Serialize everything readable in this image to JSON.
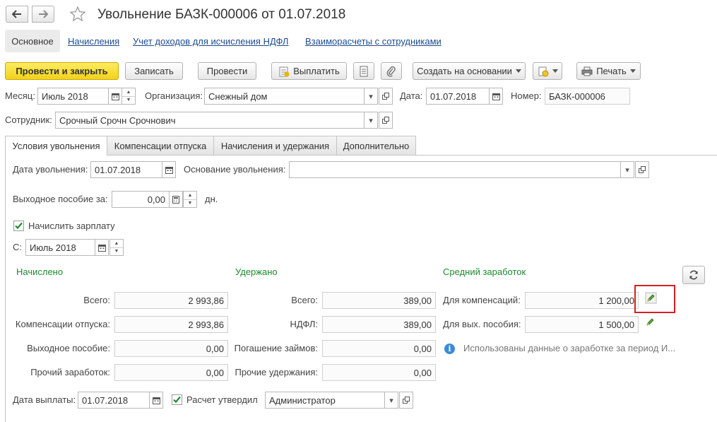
{
  "window": {
    "title": "Увольнение БАЗК-000006 от 01.07.2018"
  },
  "nav": {
    "back_icon": "arrow-left-icon",
    "forward_icon": "arrow-right-icon",
    "favorite_icon": "star-icon"
  },
  "sections": {
    "main": "Основное",
    "accruals": "Начисления",
    "income": "Учет доходов для исчисления НДФЛ",
    "settlements": "Взаиморасчеты с сотрудниками"
  },
  "toolbar": {
    "post_close": "Провести и закрыть",
    "save": "Записать",
    "post": "Провести",
    "pay": "Выплатить",
    "create_based": "Создать на основании",
    "print": "Печать"
  },
  "header": {
    "month_label": "Месяц:",
    "month_value": "Июль 2018",
    "org_label": "Организация:",
    "org_value": "Снежный дом",
    "date_label": "Дата:",
    "date_value": "01.07.2018",
    "number_label": "Номер:",
    "number_value": "БАЗК-000006",
    "employee_label": "Сотрудник:",
    "employee_value": "Срочный Срочн Срочнович"
  },
  "tabs": [
    "Условия увольнения",
    "Компенсации отпуска",
    "Начисления и удержания",
    "Дополнительно"
  ],
  "conditions": {
    "dismissal_date_label": "Дата увольнения:",
    "dismissal_date_value": "01.07.2018",
    "reason_label": "Основание увольнения:",
    "reason_value": "",
    "severance_label": "Выходное пособие за:",
    "severance_value": "0,00",
    "severance_unit": "дн.",
    "accrue_salary_label": "Начислить зарплату",
    "accrue_salary_checked": true,
    "from_label": "С:",
    "from_value": "Июль 2018"
  },
  "accrued": {
    "heading": "Начислено",
    "total_label": "Всего:",
    "total_value": "2 993,86",
    "vacation_label": "Компенсации отпуска:",
    "vacation_value": "2 993,86",
    "severance_label": "Выходное пособие:",
    "severance_value": "0,00",
    "other_label": "Прочий заработок:",
    "other_value": "0,00"
  },
  "withheld": {
    "heading": "Удержано",
    "total_label": "Всего:",
    "total_value": "389,00",
    "ndfl_label": "НДФЛ:",
    "ndfl_value": "389,00",
    "loans_label": "Погашение займов:",
    "loans_value": "0,00",
    "other_label": "Прочие удержания:",
    "other_value": "0,00"
  },
  "average": {
    "heading": "Средний заработок",
    "comp_label": "Для компенсаций:",
    "comp_value": "1 200,00",
    "sev_label": "Для вых. пособия:",
    "sev_value": "1 500,00",
    "info_text": "Использованы данные о заработке за период И..."
  },
  "footer": {
    "pay_date_label": "Дата выплаты:",
    "pay_date_value": "01.07.2018",
    "approved_label": "Расчет утвердил",
    "approved_checked": true,
    "approver_value": "Администратор"
  },
  "colors": {
    "accent_yellow": "#f5d728",
    "link_blue": "#1b4c8f",
    "section_green": "#1e8a2e",
    "highlight_red": "#d42020"
  }
}
